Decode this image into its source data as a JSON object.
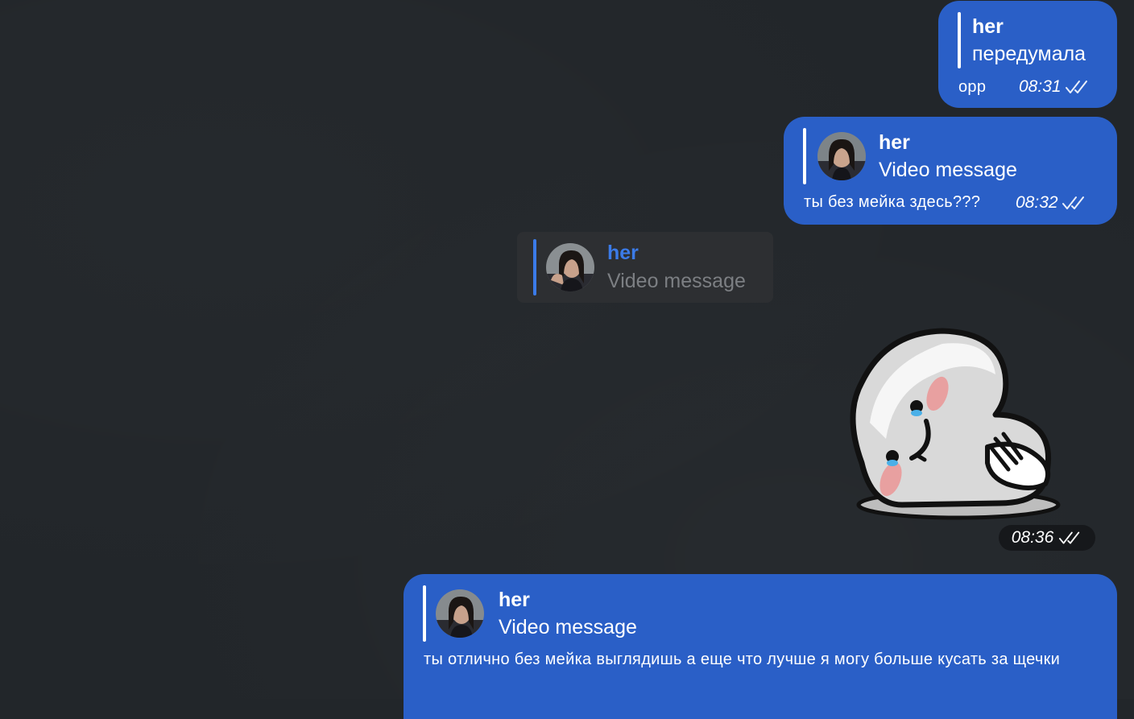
{
  "messages": [
    {
      "reply_name": "her",
      "reply_text": "передумала",
      "text": "opp",
      "time": "08:31"
    },
    {
      "reply_name": "her",
      "reply_text": "Video message",
      "text": "ты без мейка здесь???",
      "time": "08:32"
    },
    {
      "reply_name": "her",
      "reply_text": "Video message",
      "text": "ты отлично без мейка выглядишь а еще что лучше я могу больше кусать за щечки"
    }
  ],
  "pinned_reply": {
    "name": "her",
    "text": "Video message"
  },
  "sticker": {
    "icon": "crying-ghost-sticker",
    "time": "08:36"
  },
  "colors": {
    "background": "#22262a",
    "outgoing_bubble": "#2a5fc7",
    "pinned_bg": "#2d2f32",
    "accent": "#3b7be8"
  }
}
